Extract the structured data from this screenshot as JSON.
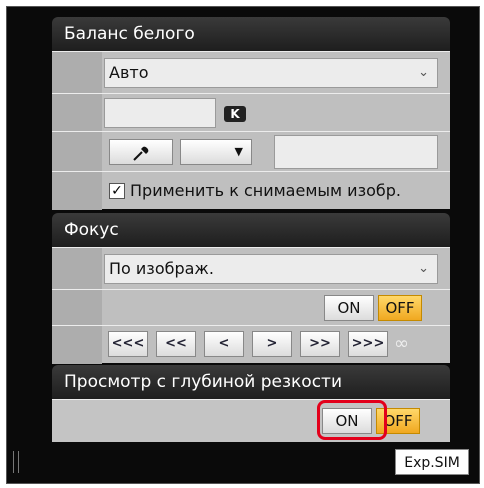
{
  "white_balance": {
    "title": "Баланс белого",
    "mode_value": "Авто",
    "kelvin_unit": "K",
    "eyedropper_icon": "eyedropper-icon",
    "small_select_arrow": "▼",
    "apply_checkbox_label": "Применить к снимаемым изобр.",
    "apply_checked": true
  },
  "focus": {
    "title": "Фокус",
    "mode_value": "По изображ.",
    "on_label": "ON",
    "off_label": "OFF",
    "nav": [
      "<<<",
      "<<",
      "<",
      ">",
      ">>",
      ">>>"
    ],
    "infinity": "∞"
  },
  "dof_preview": {
    "title": "Просмотр с глубиной резкости",
    "on_label": "ON",
    "off_label": "OFF"
  },
  "footer": {
    "exp_sim_label": "Exp.SIM"
  },
  "colors": {
    "off_button": "#f0a820",
    "highlight": "#e3001b"
  }
}
